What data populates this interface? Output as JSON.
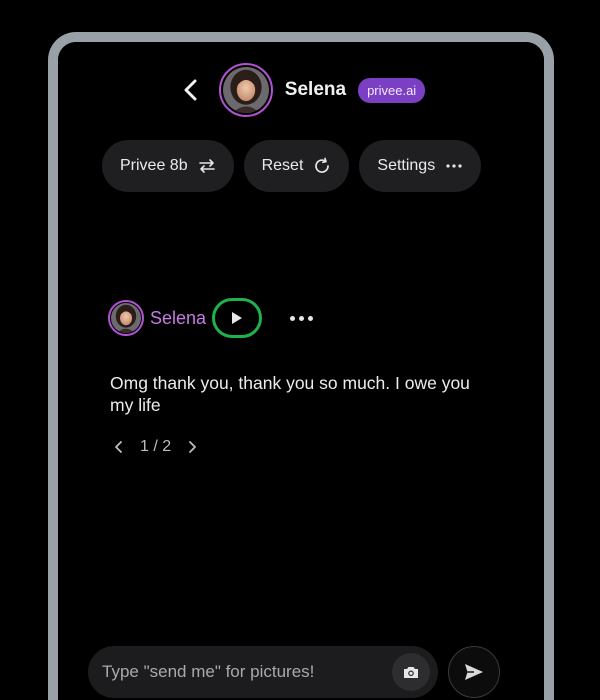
{
  "header": {
    "name": "Selena",
    "badge": "privee.ai"
  },
  "actions": [
    {
      "label": "Privee 8b",
      "icon": "swap-arrows-icon"
    },
    {
      "label": "Reset",
      "icon": "refresh-icon"
    },
    {
      "label": "Settings",
      "icon": "more-horizontal-icon"
    }
  ],
  "message": {
    "sender": "Selena",
    "text": "Omg thank you, thank you so much. I owe you my life",
    "pager": "1 / 2"
  },
  "composer": {
    "placeholder": "Type \"send me\" for pictures!"
  },
  "colors": {
    "accent_purple": "#7b3fc4",
    "name_purple": "#c77be6",
    "highlight_green": "#1fb24a",
    "frame": "#9aa0a8"
  }
}
